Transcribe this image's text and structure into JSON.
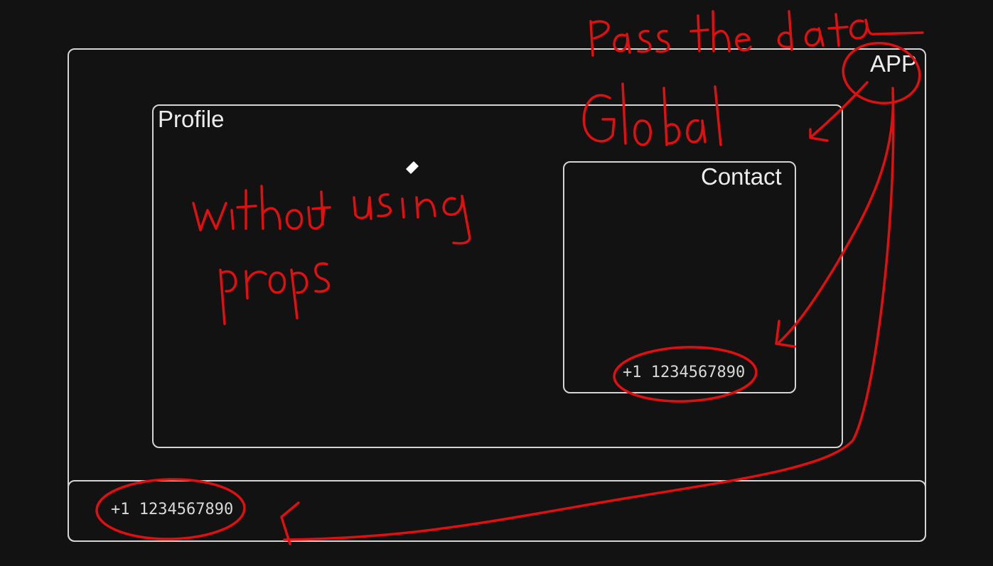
{
  "components": {
    "app": {
      "label": "APP"
    },
    "profile": {
      "label": "Profile"
    },
    "contact": {
      "label": "Contact",
      "phone": "+1 1234567890"
    },
    "footer": {
      "phone": "+1 1234567890"
    }
  },
  "annotations": {
    "pass_the_data": "Pass the data",
    "global": "Global",
    "without_using_props": "without using props"
  },
  "colors": {
    "background": "#121212",
    "box_border": "#d4d4d4",
    "text": "#ececec",
    "annotation_ink": "#e01010"
  },
  "icons": {
    "cursor": "pen-cursor-icon"
  }
}
